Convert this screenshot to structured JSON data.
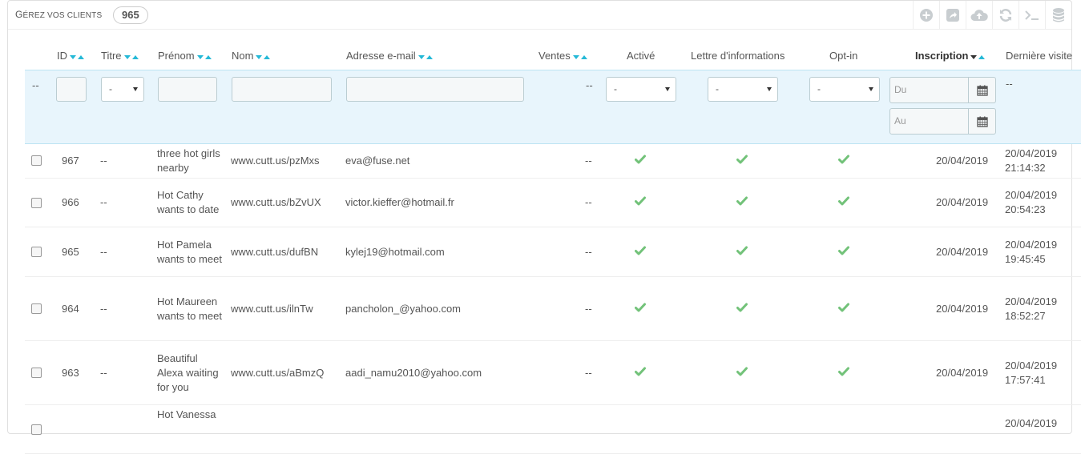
{
  "header": {
    "title_first": "G",
    "title_rest": "érez vos clients",
    "count": "965",
    "toolbar": [
      {
        "name": "add-icon"
      },
      {
        "name": "export-icon"
      },
      {
        "name": "upload-icon"
      },
      {
        "name": "refresh-icon"
      },
      {
        "name": "terminal-icon"
      },
      {
        "name": "database-icon"
      }
    ]
  },
  "columns": {
    "id": "ID",
    "titre": "Titre",
    "prenom": "Prénom",
    "nom": "Nom",
    "email": "Adresse e-mail",
    "ventes": "Ventes",
    "active": "Activé",
    "newsletter": "Lettre d'informations",
    "optin": "Opt-in",
    "inscription": "Inscription",
    "derniere": "Dernière visite"
  },
  "filters": {
    "bulk": "--",
    "titre_select": "-",
    "ventes": "--",
    "active_select": "-",
    "newsletter_select": "-",
    "optin_select": "-",
    "date_from": "Du",
    "date_to": "Au",
    "derniere": "--"
  },
  "rows": [
    {
      "id": "967",
      "titre": "--",
      "prenom": "three hot girls nearby",
      "nom": "www.cutt.us/pzMxs",
      "email": "eva@fuse.net",
      "ventes": "--",
      "inscription": "20/04/2019",
      "derniere_date": "20/04/2019",
      "derniere_time": "21:14:32"
    },
    {
      "id": "966",
      "titre": "--",
      "prenom": "Hot Cathy wants to date",
      "nom": "www.cutt.us/bZvUX",
      "email": "victor.kieffer@hotmail.fr",
      "ventes": "--",
      "inscription": "20/04/2019",
      "derniere_date": "20/04/2019",
      "derniere_time": "20:54:23"
    },
    {
      "id": "965",
      "titre": "--",
      "prenom": "Hot Pamela wants to meet",
      "nom": "www.cutt.us/dufBN",
      "email": "kylej19@hotmail.com",
      "ventes": "--",
      "inscription": "20/04/2019",
      "derniere_date": "20/04/2019",
      "derniere_time": "19:45:45"
    },
    {
      "id": "964",
      "titre": "--",
      "prenom": "Hot Maureen wants to meet",
      "nom": "www.cutt.us/ilnTw",
      "email": "pancholon_@yahoo.com",
      "ventes": "--",
      "inscription": "20/04/2019",
      "derniere_date": "20/04/2019",
      "derniere_time": "18:52:27"
    },
    {
      "id": "963",
      "titre": "--",
      "prenom": "Beautiful Alexa waiting for you",
      "nom": "www.cutt.us/aBmzQ",
      "email": "aadi_namu2010@yahoo.com",
      "ventes": "--",
      "inscription": "20/04/2019",
      "derniere_date": "20/04/2019",
      "derniere_time": "17:57:41"
    },
    {
      "id": "",
      "titre": "",
      "prenom": "Hot Vanessa",
      "nom": "",
      "email": "",
      "ventes": "",
      "inscription": "",
      "derniere_date": "20/04/2019",
      "derniere_time": ""
    }
  ],
  "colors": {
    "accent": "#25b9d7",
    "check": "#72c279",
    "filter_bg": "#e8f5fc"
  }
}
